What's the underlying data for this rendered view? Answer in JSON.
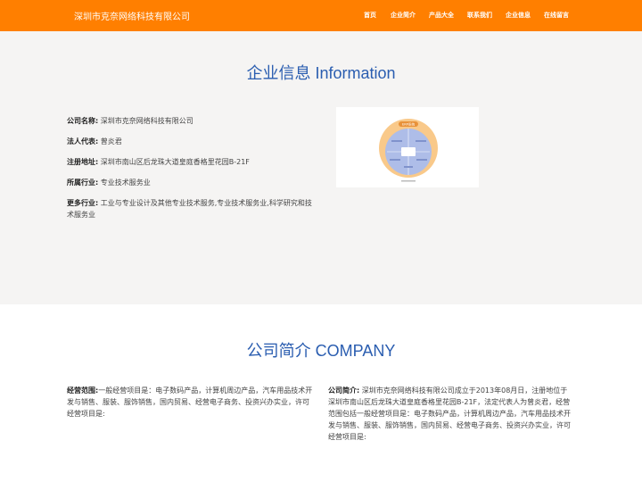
{
  "header": {
    "site_title": "深圳市克奈网络科技有限公司",
    "nav": [
      "首页",
      "企业简介",
      "产品大全",
      "联系我们",
      "企业信息",
      "在线留言"
    ]
  },
  "info": {
    "title": "企业信息 Information",
    "rows": [
      {
        "label": "公司名称:",
        "value": "深圳市克奈网络科技有限公司"
      },
      {
        "label": "法人代表:",
        "value": "曾炎君"
      },
      {
        "label": "注册地址:",
        "value": "深圳市南山区后龙珠大道皇庭香格里花园B-21F"
      },
      {
        "label": "所属行业:",
        "value": "专业技术服务业"
      },
      {
        "label": "更多行业:",
        "value": "工业与专业设计及其他专业技术服务,专业技术服务业,科学研究和技术服务业"
      }
    ],
    "diagram": {
      "heading": "ERP系统"
    }
  },
  "company": {
    "title": "公司简介 COMPANY",
    "scope_label": "经营范围:",
    "scope_text": "一般经营项目是：电子数码产品，计算机周边产品，汽车用品技术开发与销售、服装、服饰销售，国内贸易、经营电子商务、投资兴办实业，许可经营项目是:",
    "intro_label": "公司简介:",
    "intro_text": "深圳市克奈网络科技有限公司成立于2013年08月日，注册地位于深圳市南山区后龙珠大道皇庭香格里花园B-21F，法定代表人为曾炎君，经营范围包括一般经营项目是：电子数码产品，计算机周边产品，汽车用品技术开发与销售、服装、服饰销售，国内贸易、经营电子商务、投资兴办实业，许可经营项目是:"
  },
  "colors": {
    "header_bg": "#ff7f00",
    "title_blue": "#2a5db0",
    "info_bg": "#f5f4f3"
  }
}
